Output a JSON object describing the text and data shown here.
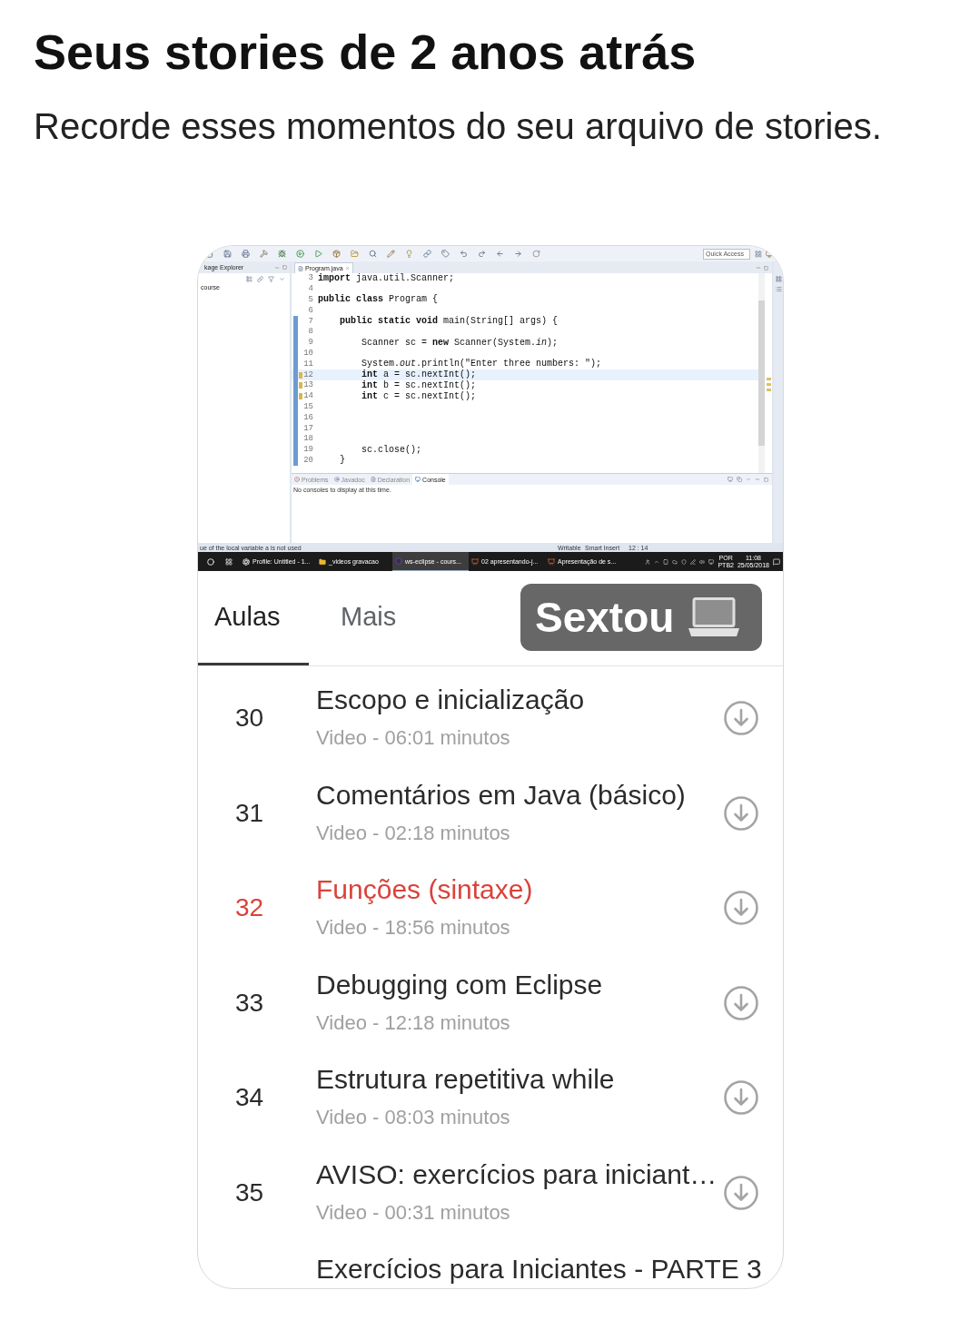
{
  "header": {
    "title": "Seus stories de 2 anos atrás",
    "subtitle": "Recorde esses momentos do seu arquivo de stories."
  },
  "story": {
    "screenshot": {
      "toolbar": {
        "search": {
          "placeholder": "Quick Access"
        }
      },
      "explorer": {
        "tab": "kage Explorer",
        "items": [
          "course"
        ]
      },
      "editor": {
        "tab": "Program.java",
        "lines": [
          {
            "number": "3",
            "code": "**import** java.util.Scanner;",
            "changed": false,
            "warning": false,
            "current": false
          },
          {
            "number": "4",
            "changed": false,
            "warning": false,
            "current": false
          },
          {
            "number": "5",
            "code": "**public** **class** Program {",
            "changed": false,
            "warning": false,
            "current": false
          },
          {
            "number": "6",
            "changed": false,
            "warning": false,
            "current": false
          },
          {
            "number": "7",
            "code": "    **public** **static** **void** main(String[] args) {",
            "changed": true,
            "warning": false,
            "current": false
          },
          {
            "number": "8",
            "changed": true,
            "warning": false,
            "current": false
          },
          {
            "number": "9",
            "code": "        Scanner sc = **new** Scanner(System.*in*);",
            "changed": true,
            "warning": false,
            "current": false
          },
          {
            "number": "10",
            "changed": true,
            "warning": false,
            "current": false
          },
          {
            "number": "11",
            "code": "        System.*out*.println(\"Enter three numbers: \");",
            "changed": true,
            "warning": false,
            "current": false
          },
          {
            "number": "12",
            "code": "        **int** a = sc.nextInt();",
            "changed": true,
            "warning": true,
            "current": true
          },
          {
            "number": "13",
            "code": "        **int** b = sc.nextInt();",
            "changed": true,
            "warning": true,
            "current": false
          },
          {
            "number": "14",
            "code": "        **int** c = sc.nextInt();",
            "changed": true,
            "warning": true,
            "current": false
          },
          {
            "number": "15",
            "changed": true,
            "warning": false,
            "current": false
          },
          {
            "number": "16",
            "changed": true,
            "warning": false,
            "current": false
          },
          {
            "number": "17",
            "changed": true,
            "warning": false,
            "current": false
          },
          {
            "number": "18",
            "changed": true,
            "warning": false,
            "current": false
          },
          {
            "number": "19",
            "code": "        sc.close();",
            "changed": true,
            "warning": false,
            "current": false
          },
          {
            "number": "20",
            "code": "    }",
            "changed": true,
            "warning": false,
            "current": false
          }
        ]
      },
      "console": {
        "tabs": [
          {
            "label": "Problems",
            "selected": false
          },
          {
            "label": "Javadoc",
            "selected": false
          },
          {
            "label": "Declaration",
            "selected": false
          },
          {
            "label": "Console",
            "selected": true
          }
        ],
        "message": "No consoles to display at this time."
      },
      "status_bar": {
        "message": "ue of the local variable a is not used",
        "fields": [
          "Writable",
          "Smart Insert",
          "12 : 14"
        ]
      },
      "taskbar": {
        "items": [
          {
            "label": "Profile: Untitled - 1...",
            "kind": "recorder",
            "selected": false
          },
          {
            "label": "_videos gravacao",
            "kind": "folder",
            "selected": false
          },
          {
            "label": "ws-eclipse - cours...",
            "kind": "ide",
            "selected": true
          },
          {
            "label": "02 apresentando-j...",
            "kind": "slides",
            "selected": false
          },
          {
            "label": "Apresentação de s...",
            "kind": "slides",
            "selected": false
          }
        ],
        "language": "POR",
        "layout": "PTB2",
        "time": "11:08",
        "date": "25/05/2018"
      }
    },
    "sticker": {
      "text": "Sextou"
    },
    "tabs": [
      {
        "label": "Aulas",
        "selected": true
      },
      {
        "label": "Mais",
        "selected": false
      }
    ],
    "lessons": [
      {
        "number": "30",
        "title": "Escopo e inicialização",
        "subtitle": "Video - 06:01 minutos",
        "selected": false
      },
      {
        "number": "31",
        "title": "Comentários em Java (básico)",
        "subtitle": "Video - 02:18 minutos",
        "selected": false
      },
      {
        "number": "32",
        "title": "Funções (sintaxe)",
        "subtitle": "Video - 18:56 minutos",
        "selected": true
      },
      {
        "number": "33",
        "title": "Debugging com Eclipse",
        "subtitle": "Video - 12:18 minutos",
        "selected": false
      },
      {
        "number": "34",
        "title": "Estrutura repetitiva while",
        "subtitle": "Video - 08:03 minutos",
        "selected": false
      },
      {
        "number": "35",
        "title": "AVISO: exercícios para iniciant…",
        "subtitle": "Video - 00:31 minutos",
        "selected": false
      },
      {
        "title": "Exercícios para Iniciantes - PARTE 3",
        "selected": false
      }
    ]
  }
}
